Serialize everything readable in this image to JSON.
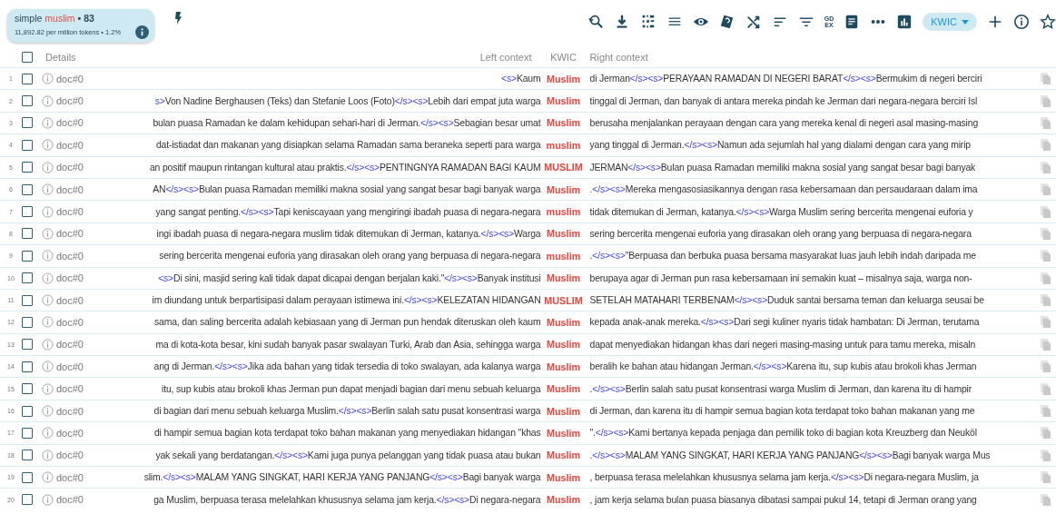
{
  "query": {
    "parts": [
      {
        "kind": "plain",
        "text": "simple"
      },
      {
        "kind": "term",
        "text": "muslim"
      },
      {
        "kind": "count",
        "text": "• 83"
      }
    ],
    "stats": "11,892.82 per million tokens • 1.2%"
  },
  "toolbar": {
    "gdex_label": [
      "GD",
      "EX"
    ],
    "view_dropdown": "KWIC"
  },
  "header": {
    "checked": false,
    "details": "Details",
    "left": "Left context",
    "kwic": "KWIC",
    "right": "Right context"
  },
  "rows": [
    {
      "num": "1",
      "checked": false,
      "doc": "doc#0",
      "left": [
        {
          "kind": "tag",
          "text": "<s>"
        },
        {
          "kind": "text",
          "text": "Kaum"
        }
      ],
      "kwic": "Muslim",
      "right": [
        {
          "kind": "text",
          "text": "di Jerman"
        },
        {
          "kind": "tag",
          "text": "</s><s>"
        },
        {
          "kind": "text",
          "text": "PERAYAAN RAMADAN DI NEGERI BARAT"
        },
        {
          "kind": "tag",
          "text": "</s><s>"
        },
        {
          "kind": "text",
          "text": "Bermukim di negeri berciri"
        }
      ]
    },
    {
      "num": "2",
      "checked": false,
      "doc": "doc#0",
      "left": [
        {
          "kind": "tag",
          "text": "s>"
        },
        {
          "kind": "text",
          "text": "Von Nadine Berghausen (Teks) dan Stefanie Loos (Foto)"
        },
        {
          "kind": "tag",
          "text": "</s><s>"
        },
        {
          "kind": "text",
          "text": "Lebih dari empat juta warga"
        }
      ],
      "kwic": "Muslim",
      "right": [
        {
          "kind": "text",
          "text": "tinggal di Jerman, dan banyak di antara mereka pindah ke Jerman dari negara-negara berciri Isl"
        }
      ]
    },
    {
      "num": "3",
      "checked": false,
      "doc": "doc#0",
      "left": [
        {
          "kind": "text",
          "text": "bulan puasa Ramadan ke dalam kehidupan sehari-hari di Jerman."
        },
        {
          "kind": "tag",
          "text": "</s><s>"
        },
        {
          "kind": "text",
          "text": "Sebagian besar umat"
        }
      ],
      "kwic": "Muslim",
      "right": [
        {
          "kind": "text",
          "text": "berusaha menjalankan perayaan dengan cara yang mereka kenal di negeri asal masing-masing"
        }
      ]
    },
    {
      "num": "4",
      "checked": false,
      "doc": "doc#0",
      "left": [
        {
          "kind": "text",
          "text": "dat-istiadat dan makanan yang disiapkan selama Ramadan sama beraneka seperti para warga"
        }
      ],
      "kwic": "muslim",
      "right": [
        {
          "kind": "text",
          "text": "yang tinggal di Jerman."
        },
        {
          "kind": "tag",
          "text": "</s><s>"
        },
        {
          "kind": "text",
          "text": "Namun ada sejumlah hal yang dialami dengan cara yang mirip"
        }
      ]
    },
    {
      "num": "5",
      "checked": false,
      "doc": "doc#0",
      "left": [
        {
          "kind": "text",
          "text": "an positif maupun rintangan kultural atau praktis."
        },
        {
          "kind": "tag",
          "text": "</s><s>"
        },
        {
          "kind": "text",
          "text": "PENTINGNYA RAMADAN BAGI KAUM"
        }
      ],
      "kwic": "MUSLIM",
      "right": [
        {
          "kind": "text",
          "text": "JERMAN"
        },
        {
          "kind": "tag",
          "text": "</s><s>"
        },
        {
          "kind": "text",
          "text": "Bulan puasa Ramadan memiliki makna sosial yang sangat besar bagi banyak"
        }
      ]
    },
    {
      "num": "6",
      "checked": false,
      "doc": "doc#0",
      "left": [
        {
          "kind": "text",
          "text": "AN"
        },
        {
          "kind": "tag",
          "text": "</s><s>"
        },
        {
          "kind": "text",
          "text": "Bulan puasa Ramadan memiliki makna sosial yang sangat besar bagi banyak warga"
        }
      ],
      "kwic": "Muslim",
      "right": [
        {
          "kind": "text",
          "text": "."
        },
        {
          "kind": "tag",
          "text": "</s><s>"
        },
        {
          "kind": "text",
          "text": "Mereka mengasosiasikannya dengan rasa kebersamaan dan persaudaraan dalam ima"
        }
      ]
    },
    {
      "num": "7",
      "checked": false,
      "doc": "doc#0",
      "left": [
        {
          "kind": "text",
          "text": "yang sangat penting."
        },
        {
          "kind": "tag",
          "text": "</s><s>"
        },
        {
          "kind": "text",
          "text": "Tapi keniscayaan yang mengiringi ibadah puasa di negara-negara"
        }
      ],
      "kwic": "muslim",
      "right": [
        {
          "kind": "text",
          "text": "tidak ditemukan di Jerman, katanya."
        },
        {
          "kind": "tag",
          "text": "</s><s>"
        },
        {
          "kind": "text",
          "text": "Warga Muslim sering bercerita mengenai euforia y"
        }
      ]
    },
    {
      "num": "8",
      "checked": false,
      "doc": "doc#0",
      "left": [
        {
          "kind": "text",
          "text": "ingi ibadah puasa di negara-negara muslim tidak ditemukan di Jerman, katanya."
        },
        {
          "kind": "tag",
          "text": "</s><s>"
        },
        {
          "kind": "text",
          "text": "Warga"
        }
      ],
      "kwic": "Muslim",
      "right": [
        {
          "kind": "text",
          "text": "sering bercerita mengenai euforia yang dirasakan oleh orang yang berpuasa di negara-negara"
        }
      ]
    },
    {
      "num": "9",
      "checked": false,
      "doc": "doc#0",
      "left": [
        {
          "kind": "text",
          "text": "sering bercerita mengenai euforia yang dirasakan oleh orang yang berpuasa di negara-negara"
        }
      ],
      "kwic": "muslim",
      "right": [
        {
          "kind": "text",
          "text": "."
        },
        {
          "kind": "tag",
          "text": "</s><s>"
        },
        {
          "kind": "text",
          "text": "\"Berpuasa dan berbuka puasa bersama masyarakat luas jauh lebih indah daripada me"
        }
      ]
    },
    {
      "num": "10",
      "checked": false,
      "doc": "doc#0",
      "left": [
        {
          "kind": "tag",
          "text": "<s>"
        },
        {
          "kind": "text",
          "text": "Di sini, masjid sering kali tidak dapat dicapai dengan berjalan kaki.\""
        },
        {
          "kind": "tag",
          "text": "</s><s>"
        },
        {
          "kind": "text",
          "text": "Banyak institusi"
        }
      ],
      "kwic": "Muslim",
      "right": [
        {
          "kind": "text",
          "text": "berupaya agar di Jerman pun rasa kebersamaan ini semakin kuat – misalnya saja, warga non-"
        }
      ]
    },
    {
      "num": "11",
      "checked": false,
      "doc": "doc#0",
      "left": [
        {
          "kind": "text",
          "text": "im diundang untuk berpartisipasi dalam perayaan istimewa ini."
        },
        {
          "kind": "tag",
          "text": "</s><s>"
        },
        {
          "kind": "text",
          "text": "KELEZATAN HIDANGAN"
        }
      ],
      "kwic": "MUSLIM",
      "right": [
        {
          "kind": "text",
          "text": "SETELAH MATAHARI TERBENAM"
        },
        {
          "kind": "tag",
          "text": "</s><s>"
        },
        {
          "kind": "text",
          "text": "Duduk santai bersama teman dan keluarga seusai be"
        }
      ]
    },
    {
      "num": "12",
      "checked": false,
      "doc": "doc#0",
      "left": [
        {
          "kind": "text",
          "text": "sama, dan saling bercerita adalah kebiasaan yang di Jerman pun hendak diteruskan oleh kaum"
        }
      ],
      "kwic": "Muslim",
      "right": [
        {
          "kind": "text",
          "text": "kepada anak-anak mereka."
        },
        {
          "kind": "tag",
          "text": "</s><s>"
        },
        {
          "kind": "text",
          "text": "Dari segi kuliner nyaris tidak hambatan: Di Jerman, terutama"
        }
      ]
    },
    {
      "num": "13",
      "checked": false,
      "doc": "doc#0",
      "left": [
        {
          "kind": "text",
          "text": "ma di kota-kota besar, kini sudah banyak pasar swalayan Turki, Arab dan Asia, sehingga warga"
        }
      ],
      "kwic": "Muslim",
      "right": [
        {
          "kind": "text",
          "text": "dapat menyediakan hidangan khas dari negeri masing-masing untuk para tamu mereka, misaln"
        }
      ]
    },
    {
      "num": "14",
      "checked": false,
      "doc": "doc#0",
      "left": [
        {
          "kind": "text",
          "text": "ang di Jerman."
        },
        {
          "kind": "tag",
          "text": "</s><s>"
        },
        {
          "kind": "text",
          "text": "Jika ada bahan yang tidak tersedia di toko swalayan, ada kalanya warga"
        }
      ],
      "kwic": "Muslim",
      "right": [
        {
          "kind": "text",
          "text": "beralih ke bahan atau hidangan Jerman."
        },
        {
          "kind": "tag",
          "text": "</s><s>"
        },
        {
          "kind": "text",
          "text": "Karena itu, sup kubis atau brokoli khas Jerman"
        }
      ]
    },
    {
      "num": "15",
      "checked": false,
      "doc": "doc#0",
      "left": [
        {
          "kind": "text",
          "text": "itu, sup kubis atau brokoli khas Jerman pun dapat menjadi bagian dari menu sebuah keluarga"
        }
      ],
      "kwic": "Muslim",
      "right": [
        {
          "kind": "text",
          "text": "."
        },
        {
          "kind": "tag",
          "text": "</s><s>"
        },
        {
          "kind": "text",
          "text": "Berlin salah satu pusat konsentrasi warga Muslim di Jerman, dan karena itu di hampir"
        }
      ]
    },
    {
      "num": "16",
      "checked": false,
      "doc": "doc#0",
      "left": [
        {
          "kind": "text",
          "text": "di bagian dari menu sebuah keluarga Muslim."
        },
        {
          "kind": "tag",
          "text": "</s><s>"
        },
        {
          "kind": "text",
          "text": "Berlin salah satu pusat konsentrasi warga"
        }
      ],
      "kwic": "Muslim",
      "right": [
        {
          "kind": "text",
          "text": "di Jerman, dan karena itu di hampir semua bagian kota terdapat toko bahan makanan yang me"
        }
      ]
    },
    {
      "num": "17",
      "checked": false,
      "doc": "doc#0",
      "left": [
        {
          "kind": "text",
          "text": "di hampir semua bagian kota terdapat toko bahan makanan yang menyediakan hidangan \"khas"
        }
      ],
      "kwic": "Muslim",
      "right": [
        {
          "kind": "text",
          "text": "\"."
        },
        {
          "kind": "tag",
          "text": "</s><s>"
        },
        {
          "kind": "text",
          "text": "Kami bertanya kepada penjaga dan pemilik toko di bagian kota Kreuzberg dan Neuköl"
        }
      ]
    },
    {
      "num": "18",
      "checked": false,
      "doc": "doc#0",
      "left": [
        {
          "kind": "text",
          "text": "yak sekali yang berdatangan."
        },
        {
          "kind": "tag",
          "text": "</s><s>"
        },
        {
          "kind": "text",
          "text": "Kami juga punya pelanggan yang tidak puasa atau bukan"
        }
      ],
      "kwic": "Muslim",
      "right": [
        {
          "kind": "text",
          "text": "."
        },
        {
          "kind": "tag",
          "text": "</s><s>"
        },
        {
          "kind": "text",
          "text": "MALAM YANG SINGKAT, HARI KERJA YANG PANJANG"
        },
        {
          "kind": "tag",
          "text": "</s><s>"
        },
        {
          "kind": "text",
          "text": "Bagi banyak warga Mus"
        }
      ]
    },
    {
      "num": "19",
      "checked": false,
      "doc": "doc#0",
      "left": [
        {
          "kind": "text",
          "text": "slim."
        },
        {
          "kind": "tag",
          "text": "</s><s>"
        },
        {
          "kind": "text",
          "text": "MALAM YANG SINGKAT, HARI KERJA YANG PANJANG"
        },
        {
          "kind": "tag",
          "text": "</s><s>"
        },
        {
          "kind": "text",
          "text": "Bagi banyak warga"
        }
      ],
      "kwic": "Muslim",
      "right": [
        {
          "kind": "text",
          "text": ", berpuasa terasa melelahkan khususnya selama jam kerja."
        },
        {
          "kind": "tag",
          "text": "</s><s>"
        },
        {
          "kind": "text",
          "text": "Di negara-negara Muslim, ja"
        }
      ]
    },
    {
      "num": "20",
      "checked": false,
      "doc": "doc#0",
      "left": [
        {
          "kind": "text",
          "text": "ga Muslim, berpuasa terasa melelahkan khususnya selama jam kerja."
        },
        {
          "kind": "tag",
          "text": "</s><s>"
        },
        {
          "kind": "text",
          "text": "Di negara-negara"
        }
      ],
      "kwic": "Muslim",
      "right": [
        {
          "kind": "text",
          "text": ", jam kerja selama bulan puasa biasanya dibatasi sampai pukul 14, tetapi di Jerman orang yang"
        }
      ]
    }
  ]
}
